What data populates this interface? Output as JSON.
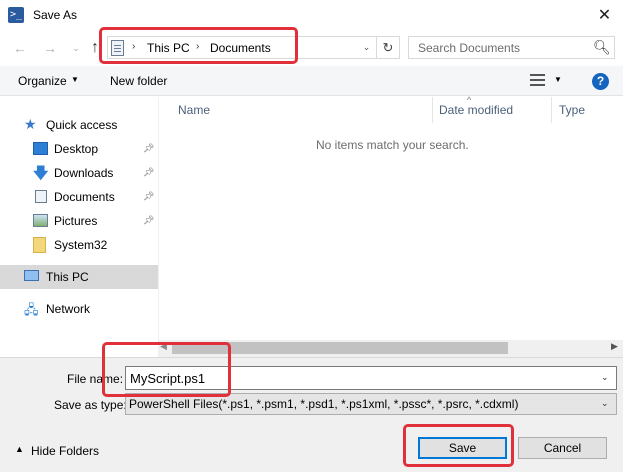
{
  "window": {
    "title": "Save As",
    "close_glyph": "✕",
    "app_icon_glyph": ">_"
  },
  "address": {
    "crumbs": [
      "This PC",
      "Documents"
    ],
    "separator": "›"
  },
  "search": {
    "placeholder": "Search Documents"
  },
  "toolbar": {
    "organize_label": "Organize",
    "new_folder_label": "New folder",
    "help_glyph": "?"
  },
  "nav_pane": {
    "items": [
      {
        "label": "Quick access",
        "icon": "star-icon",
        "pinned": false
      },
      {
        "label": "Desktop",
        "icon": "desktop-icon",
        "pinned": true
      },
      {
        "label": "Downloads",
        "icon": "download-arrow-icon",
        "pinned": true
      },
      {
        "label": "Documents",
        "icon": "document-icon",
        "pinned": true
      },
      {
        "label": "Pictures",
        "icon": "pictures-icon",
        "pinned": true
      },
      {
        "label": "System32",
        "icon": "folder-icon",
        "pinned": false
      },
      {
        "label": "This PC",
        "icon": "computer-icon",
        "pinned": false,
        "selected": true
      },
      {
        "label": "Network",
        "icon": "network-icon",
        "pinned": false
      }
    ]
  },
  "file_list": {
    "columns": [
      "Name",
      "Date modified",
      "Type"
    ],
    "empty_message": "No items match your search."
  },
  "form": {
    "file_name_label": "File name:",
    "file_name_value": "MyScript.ps1",
    "save_as_type_label": "Save as type:",
    "save_as_type_value": "PowerShell Files(*.ps1, *.psm1, *.psd1, *.ps1xml, *.pssc*, *.psrc, *.cdxml)"
  },
  "footer": {
    "hide_folders_label": "Hide Folders",
    "save_label": "Save",
    "cancel_label": "Cancel"
  },
  "colors": {
    "annotation": "#e0303a",
    "accent": "#0078d7",
    "selected_nav": "#d9d9d9"
  }
}
